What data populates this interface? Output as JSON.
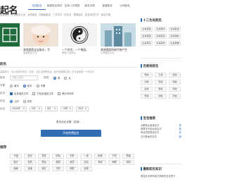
{
  "brand": "起名",
  "nav": [
    {
      "label": "在线起名",
      "active": true
    },
    {
      "label": "免费姓名测试",
      "active": false
    },
    {
      "label": "生肖八字测算",
      "active": false
    },
    {
      "label": "起名字典",
      "active": false
    },
    {
      "label": "宝宝取名",
      "active": false
    },
    {
      "label": "公司起名",
      "active": false
    }
  ],
  "subnav": "宝宝取名 · 男孩取名大全 · 女孩取名 · 双胞胎取名 · 三字名字 · 四字名 · 周易起名 · 姓名测试打分 · 起名字典",
  "tiles": [
    {
      "caption": "",
      "sub": "",
      "icon": "calligraphy-icon"
    },
    {
      "caption": "其他国家宝宝取名，不",
      "sub": "宝宝取名方法",
      "icon": "baby-photo"
    },
    {
      "caption": "一个名字，一个笔画，",
      "sub": "周易八卦起名",
      "icon": "bagua-icon"
    },
    {
      "caption": "其他国家的取代的产生",
      "sub": "公司起名大全",
      "icon": "building-photo"
    }
  ],
  "form": {
    "title": "起名",
    "note": "温馨提示：请认真填写姓氏，性别，出生日期等信息，我们将根据生辰八字为宝宝起一个好名字",
    "surname_label": "姓氏",
    "surname_placeholder": "请输入姓氏",
    "gender_label": "性别",
    "gender_options": [
      {
        "label": "男",
        "on": true
      },
      {
        "label": "女",
        "on": false
      }
    ],
    "name_len_label": "字数",
    "name_len_options": [
      {
        "label": "单字",
        "on": false
      },
      {
        "label": "双字",
        "on": true
      },
      {
        "label": "不限",
        "on": false
      }
    ],
    "fixed_label": "定字",
    "fixed_options": [
      {
        "label": "包含指定汉字",
        "on": true
      },
      {
        "label": "只包含指定汉字",
        "on": false
      },
      {
        "label": "辈分中间字",
        "on": false
      }
    ],
    "calendar_label": "历法",
    "calendar_options": [
      {
        "label": "公历",
        "on": true
      },
      {
        "label": "农历",
        "on": false
      }
    ],
    "birth_label": "出生",
    "birth_selects": [
      "2020年",
      "5月",
      "8日",
      "14时",
      "30分"
    ],
    "more_label": "更多起名设置（选填）",
    "submit_label": "开始免费起名"
  },
  "tags_head": "推荐",
  "tags": [
    "子涵",
    "浩宇",
    "梓萱",
    "欣怡",
    "宇轩",
    "一诺",
    "雨泽",
    "子墨",
    "梓涵",
    "若汐",
    "浩然",
    "思远",
    "俊熙",
    "紫萱",
    "嘉怡",
    "梓睿",
    "雨桐",
    "沐阳",
    "晨曦",
    "诗涵",
    "博文",
    "子轩",
    "明哲",
    "佳琪"
  ],
  "side": {
    "sec1_title": "十二生肖起名",
    "zodiac": [
      "生肖属鼠",
      "生肖属牛",
      "生肖属虎",
      "生肖属兔",
      "生肖属龙",
      "生肖属蛇",
      "生肖属马",
      "生肖属羊",
      "生肖属猴"
    ],
    "sec2_title": "百家姓起名",
    "surnames": [
      "李姓",
      "王姓",
      "张姓",
      "刘姓",
      "陈姓",
      "杨姓",
      "赵姓",
      "黄姓",
      "周姓",
      "吴姓",
      "徐姓",
      "孙姓"
    ],
    "sec3_title": "宝宝推荐",
    "list": [
      {
        "l": "大眼睛女宝宝名字",
        "r": "热"
      },
      {
        "l": "带草字头的女孩名字",
        "r": "新"
      },
      {
        "l": "有诗意的男孩名字",
        "r": "热"
      },
      {
        "l": "五行缺木的名字",
        "r": "新"
      }
    ],
    "sec4_title": "最新起名知识",
    "news": "男孩名字带有地方风味的文化意义"
  }
}
